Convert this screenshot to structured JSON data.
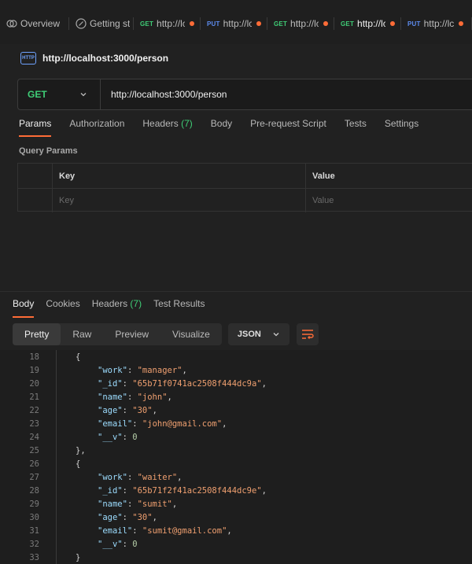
{
  "tabs": [
    {
      "kind": "overview",
      "label": "Overview",
      "icon": "overview-icon"
    },
    {
      "kind": "getting",
      "label": "Getting st",
      "icon": "getting-started-icon"
    },
    {
      "kind": "req",
      "method": "GET",
      "label": "http://lc",
      "unsaved": true
    },
    {
      "kind": "req",
      "method": "PUT",
      "label": "http://lc",
      "unsaved": true
    },
    {
      "kind": "req",
      "method": "GET",
      "label": "http://lc",
      "unsaved": true
    },
    {
      "kind": "req",
      "method": "GET",
      "label": "http://lc",
      "unsaved": true,
      "active": true
    },
    {
      "kind": "req",
      "method": "PUT",
      "label": "http://lc",
      "unsaved": true
    }
  ],
  "request": {
    "badge": "HTTP",
    "title": "http://localhost:3000/person",
    "method": "GET",
    "url": "http://localhost:3000/person"
  },
  "request_tabs": {
    "params": "Params",
    "authorization": "Authorization",
    "headers": "Headers",
    "headers_count": "(7)",
    "body": "Body",
    "prerequest": "Pre-request Script",
    "tests": "Tests",
    "settings": "Settings"
  },
  "query_params": {
    "label": "Query Params",
    "key_header": "Key",
    "value_header": "Value",
    "key_placeholder": "Key",
    "value_placeholder": "Value"
  },
  "response_tabs": {
    "body": "Body",
    "cookies": "Cookies",
    "headers": "Headers",
    "headers_count": "(7)",
    "test_results": "Test Results"
  },
  "view": {
    "pretty": "Pretty",
    "raw": "Raw",
    "preview": "Preview",
    "visualize": "Visualize",
    "format": "JSON"
  },
  "colors": {
    "accent": "#ff6c37",
    "get": "#3fcd76",
    "put": "#5d8cf0",
    "json_key": "#9cdcfe",
    "json_string": "#f0a070",
    "json_number": "#b5cea8"
  },
  "code_lines": [
    {
      "n": "18",
      "kind": "open",
      "text": "{"
    },
    {
      "n": "19",
      "kind": "kv",
      "key": "\"work\"",
      "value": "\"manager\"",
      "vtype": "s",
      "comma": true
    },
    {
      "n": "20",
      "kind": "kv",
      "key": "\"_id\"",
      "value": "\"65b71f0741ac2508f444dc9a\"",
      "vtype": "s",
      "comma": true
    },
    {
      "n": "21",
      "kind": "kv",
      "key": "\"name\"",
      "value": "\"john\"",
      "vtype": "s",
      "comma": true
    },
    {
      "n": "22",
      "kind": "kv",
      "key": "\"age\"",
      "value": "\"30\"",
      "vtype": "s",
      "comma": true
    },
    {
      "n": "23",
      "kind": "kv",
      "key": "\"email\"",
      "value": "\"john@gmail.com\"",
      "vtype": "s",
      "comma": true
    },
    {
      "n": "24",
      "kind": "kv",
      "key": "\"__v\"",
      "value": "0",
      "vtype": "n",
      "comma": false
    },
    {
      "n": "25",
      "kind": "close",
      "text": "},"
    },
    {
      "n": "26",
      "kind": "open",
      "text": "{"
    },
    {
      "n": "27",
      "kind": "kv",
      "key": "\"work\"",
      "value": "\"waiter\"",
      "vtype": "s",
      "comma": true
    },
    {
      "n": "28",
      "kind": "kv",
      "key": "\"_id\"",
      "value": "\"65b71f2f41ac2508f444dc9e\"",
      "vtype": "s",
      "comma": true
    },
    {
      "n": "29",
      "kind": "kv",
      "key": "\"name\"",
      "value": "\"sumit\"",
      "vtype": "s",
      "comma": true
    },
    {
      "n": "30",
      "kind": "kv",
      "key": "\"age\"",
      "value": "\"30\"",
      "vtype": "s",
      "comma": true
    },
    {
      "n": "31",
      "kind": "kv",
      "key": "\"email\"",
      "value": "\"sumit@gmail.com\"",
      "vtype": "s",
      "comma": true
    },
    {
      "n": "32",
      "kind": "kv",
      "key": "\"__v\"",
      "value": "0",
      "vtype": "n",
      "comma": false
    },
    {
      "n": "33",
      "kind": "close",
      "text": "}"
    }
  ]
}
